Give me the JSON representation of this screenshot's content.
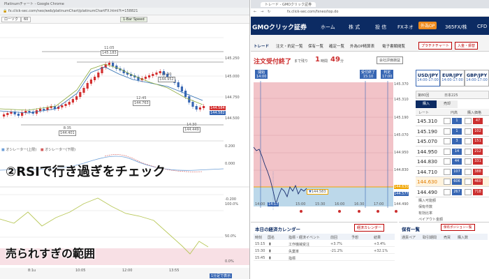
{
  "left": {
    "tab_title": "Platinumチャート - Google Chrome",
    "url": "fx.click-sec.com/neo/web/platinumChart/platinumChartFX.html?t=158821",
    "toolbar_chip1": "ローソク",
    "toolbar_chip2": "60",
    "speed_label": "1-Bar Speed",
    "price_scale": [
      "145.250",
      "145.000",
      "144.750",
      "144.500"
    ],
    "price_last": "144.584",
    "price_last2": "144.582",
    "annotations": {
      "high_time": "11:05",
      "high_val": "145.183",
      "mid_time": "13:30",
      "mid_val": "144.952",
      "mid2_time": "12:45",
      "mid2_val": "144.763",
      "low_time": "8:35",
      "low_val": "144.401",
      "low2_time": "14:30",
      "low2_val": "144.449"
    },
    "osc_legend": "オシレーター(上限)",
    "osc_legend2": "オシレーター(下限)",
    "osc_scale": [
      "0.200",
      "0.000"
    ],
    "rsi_scale": [
      "-0.200",
      "100.0%",
      "50.0%",
      "0.0%"
    ],
    "time_axis": [
      "8:1u",
      "10:05",
      "12:00",
      "13:55"
    ],
    "taskbar_hint": "1分足で表示"
  },
  "right": {
    "tab_title": "トレード - GMOクリック証券",
    "url": "fx.click-sec.com/fxneo/top.do",
    "logo": "GMOクリック証券",
    "nav": [
      "ホーム",
      "株 式",
      "投 信",
      "FXネオ",
      "外為OP",
      "365FX/株",
      "CFD"
    ],
    "subnav": [
      "トレード",
      "注文・約定一覧",
      "保有一覧",
      "確定一覧",
      "外為OP精算表",
      "電子書類閲覧"
    ],
    "subnav_buttons": [
      "プラチナチャート",
      "入金・振替"
    ],
    "status_title": "注文受付終了",
    "status_remaining": "まで残り",
    "status_time_value": "1",
    "status_time_unit1": "時間",
    "status_time_value2": "49",
    "status_time_unit2": "分",
    "assets_btn": "会社評価損益",
    "chart_labels": {
      "open_label": "開始",
      "open_time": "14:00",
      "close_label": "受付終了",
      "close_time": "15:10",
      "judge_label": "判定",
      "judge_time": "17:00",
      "current_price": "144.583"
    },
    "chart_scale": [
      "145.370",
      "145.310",
      "145.190",
      "145.070",
      "144.950",
      "144.830",
      "144.710",
      "144.630",
      "144.577",
      "144.490"
    ],
    "chart_time": [
      "14:00",
      "14:17",
      "15:00",
      "15:30",
      "16:00",
      "16:30",
      "17:00"
    ],
    "pairs": [
      {
        "code": "USD/JPY",
        "time": "14:00-17:00"
      },
      {
        "code": "EUR/JPY",
        "time": "14:00-17:00"
      },
      {
        "code": "GBP/JPY",
        "time": "14:00-17:00"
      }
    ],
    "round_label": "回数",
    "round_value": "第80回",
    "nikkei_label": "日本225",
    "buy_sell_tabs": [
      "購入",
      "売却"
    ],
    "rate_header": [
      "レート",
      "円高",
      "購入価格"
    ],
    "rates": [
      {
        "price": "145.310",
        "blue": "1",
        "red": "47"
      },
      {
        "price": "145.190",
        "blue": "1",
        "red": "102"
      },
      {
        "price": "145.070",
        "blue": "3",
        "red": "151"
      },
      {
        "price": "144.950",
        "blue": "14",
        "red": "212"
      },
      {
        "price": "144.830",
        "blue": "44",
        "red": "331"
      },
      {
        "price": "144.710",
        "blue": "107",
        "red": "388"
      },
      {
        "price": "144.630",
        "blue": "606",
        "red": "460"
      },
      {
        "price": "144.490",
        "blue": "267",
        "red": "718"
      }
    ],
    "summary": [
      "購入可能額",
      "保有件数",
      "有効比率",
      "ペイアウト金額"
    ],
    "calendar_title": "本日の経済カレンダー",
    "calendar_button": "経済カレンダー",
    "calendar_headers": [
      "時刻",
      "国名",
      "指標・経済イベント",
      "前回",
      "予想",
      "結果"
    ],
    "calendar_rows": [
      {
        "time": "15:15",
        "event": "工作機械受注",
        "prev": "+3.7%",
        "result": "+3.4%"
      },
      {
        "time": "15:30",
        "event": "失業率",
        "prev": "-21.2%",
        "result": "+32.1%"
      },
      {
        "time": "15:45",
        "event": "指標",
        "prev": "",
        "result": ""
      }
    ],
    "holdings_title": "保有一覧",
    "holdings_buttons": [
      "保有ポジション一覧",
      "保有一覧"
    ],
    "holdings_headers": [
      "通貨ペア",
      "取引期間",
      "売買",
      "購入数"
    ]
  },
  "overlay": {
    "headline": "②RSIで行き過ぎをチェック",
    "note": "売られすぎの範囲"
  },
  "colors": {
    "bull": "#d32f2f",
    "bear": "#3766b3",
    "navy": "#0c2b63",
    "pink_zone": "#f2c3c8",
    "blue_zone": "#bcd8ea"
  }
}
